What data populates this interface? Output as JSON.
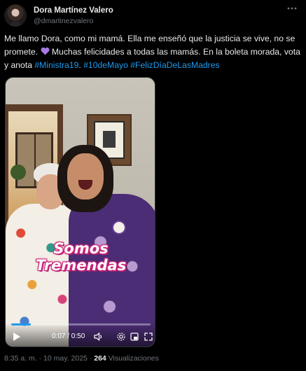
{
  "author": {
    "name": "Dora Martínez Valero",
    "handle": "@dmartinezvalero"
  },
  "more_icon": "more-horizontal-icon",
  "tweet": {
    "text_part1": "Me llamo Dora, como mi mamá. Ella me enseñó que la justicia se vive, no se promete.",
    "text_part2": "Muchas felicidades a todas las mamás. En la boleta morada, vota y anota",
    "hashtag1": "#Ministra19",
    "hashtag2": "#10deMayo",
    "hashtag3": "#FelizDíaDeLasMadres",
    "heart_color": "#a77be3"
  },
  "video": {
    "overlay_line1": "Somos",
    "overlay_line2": "Tremendas",
    "time_display": "0:07 / 0:50",
    "progress_fraction": 0.14
  },
  "meta": {
    "time": "8:35 a. m.",
    "separator": " · ",
    "date": "10 may. 2025",
    "views_count": "264",
    "views_label": "Visualizaciones"
  },
  "colors": {
    "background": "#000000",
    "text": "#e7e9ea",
    "muted": "#71767b",
    "link": "#1d9bf0"
  }
}
